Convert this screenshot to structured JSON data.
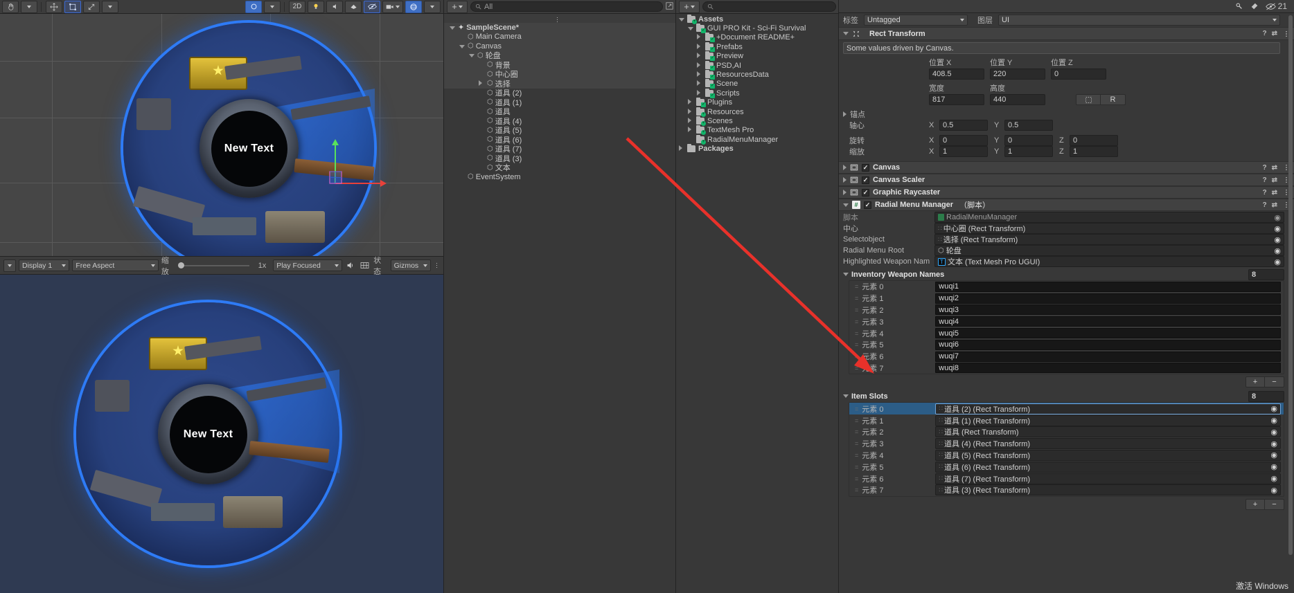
{
  "scene_toolbar": {
    "buttons": [
      "hand-tool",
      "move-tool",
      "rotate-tool",
      "scale-tool",
      "rect-tool",
      "transform-tool"
    ],
    "mode_2d": "2D",
    "light_label": "light-icon",
    "audio_label": "audio-icon",
    "fx_label": "fx-icon",
    "hidden_label": "hidden-icon",
    "gizmo_label": "gizmo-icon",
    "camera_label": "camera-icon",
    "gizmos_sphere": "gizmo-sphere-icon"
  },
  "game_toolbar": {
    "display": "Display 1",
    "aspect": "Free Aspect",
    "scale_label": "缩放",
    "scale_value": "1x",
    "play_mode": "Play Focused",
    "mute": "mute-audio-icon",
    "stats": "状态",
    "gizmos": "Gizmos"
  },
  "radial": {
    "center_text": "New Text"
  },
  "hierarchy": {
    "search_placeholder": "All",
    "add_label": "+",
    "rows": [
      {
        "label": "SampleScene*",
        "depth": 0,
        "icon": "unity-scene-icon",
        "expanded": true,
        "bold": true,
        "highlight": true
      },
      {
        "label": "Main Camera",
        "depth": 1,
        "icon": "gameobject-icon",
        "expanded": null,
        "bold": false,
        "highlight": true
      },
      {
        "label": "Canvas",
        "depth": 1,
        "icon": "gameobject-icon",
        "expanded": true,
        "bold": false,
        "highlight": true
      },
      {
        "label": "轮盘",
        "depth": 2,
        "icon": "gameobject-icon",
        "expanded": true,
        "bold": false,
        "highlight": true
      },
      {
        "label": "背景",
        "depth": 3,
        "icon": "gameobject-icon",
        "expanded": null,
        "bold": false,
        "highlight": true
      },
      {
        "label": "中心圈",
        "depth": 3,
        "icon": "gameobject-icon",
        "expanded": null,
        "bold": false,
        "highlight": true
      },
      {
        "label": "选择",
        "depth": 3,
        "icon": "gameobject-icon",
        "expanded": false,
        "bold": false,
        "highlight": true
      },
      {
        "label": "道具 (2)",
        "depth": 3,
        "icon": "gameobject-icon",
        "expanded": null,
        "bold": false,
        "highlight": false
      },
      {
        "label": "道具 (1)",
        "depth": 3,
        "icon": "gameobject-icon",
        "expanded": null,
        "bold": false,
        "highlight": false
      },
      {
        "label": "道具",
        "depth": 3,
        "icon": "gameobject-icon",
        "expanded": null,
        "bold": false,
        "highlight": false
      },
      {
        "label": "道具 (4)",
        "depth": 3,
        "icon": "gameobject-icon",
        "expanded": null,
        "bold": false,
        "highlight": false
      },
      {
        "label": "道具 (5)",
        "depth": 3,
        "icon": "gameobject-icon",
        "expanded": null,
        "bold": false,
        "highlight": false
      },
      {
        "label": "道具 (6)",
        "depth": 3,
        "icon": "gameobject-icon",
        "expanded": null,
        "bold": false,
        "highlight": false
      },
      {
        "label": "道具 (7)",
        "depth": 3,
        "icon": "gameobject-icon",
        "expanded": null,
        "bold": false,
        "highlight": false
      },
      {
        "label": "道具 (3)",
        "depth": 3,
        "icon": "gameobject-icon",
        "expanded": null,
        "bold": false,
        "highlight": false
      },
      {
        "label": "文本",
        "depth": 3,
        "icon": "gameobject-icon",
        "expanded": null,
        "bold": false,
        "highlight": false
      },
      {
        "label": "EventSystem",
        "depth": 1,
        "icon": "gameobject-icon",
        "expanded": null,
        "bold": false,
        "highlight": false
      }
    ]
  },
  "project": {
    "search_placeholder": "",
    "add_label": "+",
    "rows": [
      {
        "label": "Assets",
        "depth": 0,
        "expanded": true,
        "bold": true,
        "badge": "plus"
      },
      {
        "label": "GUI PRO Kit - Sci-Fi Survival",
        "depth": 1,
        "expanded": true,
        "bold": false,
        "badge": "check"
      },
      {
        "label": "+Document README+",
        "depth": 2,
        "expanded": false,
        "bold": false,
        "badge": "check"
      },
      {
        "label": "Prefabs",
        "depth": 2,
        "expanded": false,
        "bold": false,
        "badge": "check"
      },
      {
        "label": "Preview",
        "depth": 2,
        "expanded": false,
        "bold": false,
        "badge": "check"
      },
      {
        "label": "PSD,AI",
        "depth": 2,
        "expanded": false,
        "bold": false,
        "badge": "check"
      },
      {
        "label": "ResourcesData",
        "depth": 2,
        "expanded": false,
        "bold": false,
        "badge": "check"
      },
      {
        "label": "Scene",
        "depth": 2,
        "expanded": false,
        "bold": false,
        "badge": "check"
      },
      {
        "label": "Scripts",
        "depth": 2,
        "expanded": false,
        "bold": false,
        "badge": "check"
      },
      {
        "label": "Plugins",
        "depth": 1,
        "expanded": false,
        "bold": false,
        "badge": "check"
      },
      {
        "label": "Resources",
        "depth": 1,
        "expanded": false,
        "bold": false,
        "badge": "plus"
      },
      {
        "label": "Scenes",
        "depth": 1,
        "expanded": false,
        "bold": false,
        "badge": "plus"
      },
      {
        "label": "TextMesh Pro",
        "depth": 1,
        "expanded": false,
        "bold": false,
        "badge": "plus"
      },
      {
        "label": "RadialMenuManager",
        "depth": 1,
        "expanded": null,
        "bold": false,
        "badge": "plus"
      },
      {
        "label": "Packages",
        "depth": 0,
        "expanded": false,
        "bold": true,
        "badge": "none"
      }
    ]
  },
  "inspector": {
    "top_toolbar": {
      "lock_icon": "lock-icon",
      "pick_icon": "eyedropper-icon",
      "tag_icon": "tag-icon",
      "vis_icon": "visibility-icon",
      "vis_count": "21"
    },
    "tag_label": "标签",
    "tag_value": "Untagged",
    "layer_label": "图层",
    "layer_value": "UI",
    "rect_transform": {
      "title": "Rect Transform",
      "note": "Some values driven by Canvas.",
      "pos_x_label": "位置 X",
      "pos_x": "408.5",
      "pos_y_label": "位置 Y",
      "pos_y": "220",
      "pos_z_label": "位置 Z",
      "pos_z": "0",
      "width_label": "宽度",
      "width": "817",
      "height_label": "高度",
      "height": "440",
      "blueprint_btn": "blueprint-icon",
      "raw_btn": "R",
      "anchors_label": "锚点",
      "pivot_label": "轴心",
      "pivot_x_label": "X",
      "pivot_x": "0.5",
      "pivot_y_label": "Y",
      "pivot_y": "0.5",
      "rotation_label": "旋转",
      "rot_x_label": "X",
      "rot_x": "0",
      "rot_y_label": "Y",
      "rot_y": "0",
      "rot_z_label": "Z",
      "rot_z": "0",
      "scale_label": "缩放",
      "scl_x_label": "X",
      "scl_x": "1",
      "scl_y_label": "Y",
      "scl_y": "1",
      "scl_z_label": "Z",
      "scl_z": "1"
    },
    "components": [
      {
        "name": "Canvas",
        "icon": "canvas-icon",
        "expanded": false,
        "enabled": true,
        "suffix": ""
      },
      {
        "name": "Canvas Scaler",
        "icon": "canvas-scaler-icon",
        "expanded": false,
        "enabled": true,
        "suffix": ""
      },
      {
        "name": "Graphic Raycaster",
        "icon": "graphic-raycaster-icon",
        "expanded": false,
        "enabled": true,
        "suffix": ""
      },
      {
        "name": "Radial Menu Manager",
        "icon": "script-icon",
        "expanded": true,
        "enabled": true,
        "suffix": "（脚本）"
      }
    ],
    "radial_menu_manager": {
      "script_label": "脚本",
      "script_value": "RadialMenuManager",
      "center_label": "中心",
      "center_value": "中心圈 (Rect Transform)",
      "selectobject_label": "Selectobject",
      "selectobject_value": "选择 (Rect Transform)",
      "root_label": "Radial Menu Root",
      "root_value": "轮盘",
      "highlight_label": "Highlighted Weapon Nam",
      "highlight_value": "文本 (Text Mesh Pro UGUI)",
      "inventory_title": "Inventory Weapon Names",
      "inventory_count": "8",
      "inventory": [
        {
          "index": "元素 0",
          "value": "wuqi1"
        },
        {
          "index": "元素 1",
          "value": "wuqi2"
        },
        {
          "index": "元素 2",
          "value": "wuqi3"
        },
        {
          "index": "元素 3",
          "value": "wuqi4"
        },
        {
          "index": "元素 4",
          "value": "wuqi5"
        },
        {
          "index": "元素 5",
          "value": "wuqi6"
        },
        {
          "index": "元素 6",
          "value": "wuqi7"
        },
        {
          "index": "元素 7",
          "value": "wuqi8"
        }
      ],
      "add_btn": "+",
      "remove_btn": "−",
      "slots_title": "Item Slots",
      "slots_count": "8",
      "slots": [
        {
          "index": "元素 0",
          "value": "道具 (2) (Rect Transform)",
          "selected": true
        },
        {
          "index": "元素 1",
          "value": "道具 (1) (Rect Transform)",
          "selected": false
        },
        {
          "index": "元素 2",
          "value": "道具 (Rect Transform)",
          "selected": false
        },
        {
          "index": "元素 3",
          "value": "道具 (4) (Rect Transform)",
          "selected": false
        },
        {
          "index": "元素 4",
          "value": "道具 (5) (Rect Transform)",
          "selected": false
        },
        {
          "index": "元素 5",
          "value": "道具 (6) (Rect Transform)",
          "selected": false
        },
        {
          "index": "元素 6",
          "value": "道具 (7) (Rect Transform)",
          "selected": false
        },
        {
          "index": "元素 7",
          "value": "道具 (3) (Rect Transform)",
          "selected": false
        }
      ],
      "slots_add_btn": "+",
      "slots_remove_btn": "−"
    }
  },
  "watermark": "激活 Windows",
  "colors": {
    "accent_blue": "#2e7bf6",
    "selection_blue": "#2c5d87",
    "panel_bg": "#383838",
    "green_badge": "#12b56a",
    "red_arrow": "#e8312a"
  }
}
